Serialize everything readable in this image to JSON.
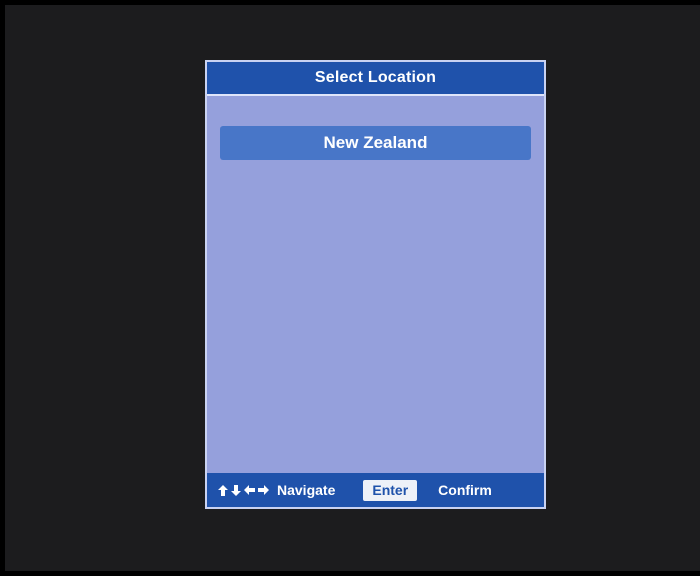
{
  "dialog": {
    "title": "Select Location",
    "items": [
      {
        "label": "New Zealand",
        "selected": true
      }
    ]
  },
  "footer": {
    "navigate_icons": [
      "arrow-up-icon",
      "arrow-down-icon",
      "arrow-left-icon",
      "arrow-right-icon"
    ],
    "navigate_label": "Navigate",
    "enter_key": "Enter",
    "confirm_label": "Confirm"
  },
  "colors": {
    "background": "#1c1c1e",
    "title_bar": "#1f52ab",
    "list_background": "#95a0dc",
    "selected_item": "#4876c8",
    "text": "#ffffff"
  }
}
